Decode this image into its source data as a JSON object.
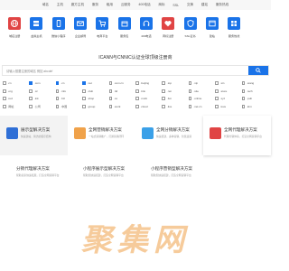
{
  "nav": {
    "items": [
      "域名",
      "主机",
      "魔方主机",
      "服务",
      "租用",
      "云服务",
      "400电话",
      "商标",
      "SSL",
      "交换",
      "建站",
      "服务热线"
    ]
  },
  "icons": [
    {
      "label": "域名注册",
      "color": "#e04444",
      "icon": "globe-icon"
    },
    {
      "label": "虚拟主机",
      "color": "#1a73e8",
      "icon": "server-icon"
    },
    {
      "label": "微信小程序",
      "color": "#1a73e8",
      "icon": "phone-icon"
    },
    {
      "label": "企业邮局",
      "color": "#1a73e8",
      "icon": "mail-icon"
    },
    {
      "label": "电商平台",
      "color": "#1a73e8",
      "icon": "cart-icon"
    },
    {
      "label": "服务包",
      "color": "#1a73e8",
      "icon": "box-icon"
    },
    {
      "label": "400电话",
      "color": "#1a73e8",
      "icon": "headset-icon"
    },
    {
      "label": "商标注册",
      "color": "#e04444",
      "icon": "heart-icon"
    },
    {
      "label": "SSL证书",
      "color": "#1a73e8",
      "icon": "shield-icon"
    },
    {
      "label": "建站",
      "color": "#1a73e8",
      "icon": "window-icon"
    },
    {
      "label": "服务热线",
      "color": "#1a73e8",
      "icon": "grid-icon"
    }
  ],
  "search": {
    "title": "ICANN与CNNIC认证全球顶级注册商",
    "placeholder": "请输入想要注册的域名 例如 abcdef"
  },
  "suffixes": [
    {
      "name": ".cn",
      "checked": false
    },
    {
      "name": ".com",
      "checked": true
    },
    {
      "name": ".cn",
      "checked": true
    },
    {
      "name": ".net",
      "checked": true
    },
    {
      "name": ".com.cn",
      "checked": false
    },
    {
      "name": ".beijing",
      "checked": false
    },
    {
      "name": ".top",
      "checked": false
    },
    {
      "name": ".vip",
      "checked": false
    },
    {
      "name": ".xin",
      "checked": false
    },
    {
      "name": ".wang",
      "checked": false
    },
    {
      "name": ".org",
      "checked": false
    },
    {
      "name": ".cc",
      "checked": false
    },
    {
      "name": ".info",
      "checked": false
    },
    {
      "name": ".club",
      "checked": false
    },
    {
      "name": ".ltd",
      "checked": false
    },
    {
      "name": ".link",
      "checked": false
    },
    {
      "name": ".ren",
      "checked": false
    },
    {
      "name": ".site",
      "checked": false
    },
    {
      "name": ".store",
      "checked": false
    },
    {
      "name": ".tech",
      "checked": false
    },
    {
      "name": ".red",
      "checked": false
    },
    {
      "name": ".ink",
      "checked": false
    },
    {
      "name": ".biz",
      "checked": false
    },
    {
      "name": ".shop",
      "checked": false
    },
    {
      "name": ".co",
      "checked": false
    },
    {
      "name": ".mobi",
      "checked": false
    },
    {
      "name": ".fun",
      "checked": false
    },
    {
      "name": ".online",
      "checked": false
    },
    {
      "name": ".xyz",
      "checked": false
    },
    {
      "name": ".pub",
      "checked": false
    },
    {
      "name": ".网址",
      "checked": false
    },
    {
      "name": ".公司",
      "checked": false
    },
    {
      "name": ".中国",
      "checked": false
    },
    {
      "name": ".group",
      "checked": false
    },
    {
      "name": ".work",
      "checked": false
    },
    {
      "name": ".cloud",
      "checked": false
    },
    {
      "name": ".live",
      "checked": false
    },
    {
      "name": ".net.cn",
      "checked": false
    },
    {
      "name": ".love",
      "checked": false
    },
    {
      "name": ".kim",
      "checked": false
    }
  ],
  "cards": [
    {
      "title": "展示型解决方案",
      "sub": "快速建站，简洁的展示结构",
      "color": "#2f6fd6"
    },
    {
      "title": "全网营销解决方案",
      "sub": "一站式营销推广，打通营销闭环",
      "color": "#f0a24a"
    },
    {
      "title": "全网分销解决方案",
      "sub": "快速搭建，多种营销，智慧运营",
      "color": "#3aa0e8"
    },
    {
      "title": "全网代理解决方案",
      "sub": "代理分销体系，打造全网营销平台",
      "color": "#e04444"
    },
    {
      "title": "分销代理解决方案",
      "sub": "帮助商家快速拓展，打造全网营销平台",
      "color": "#2f6fd6"
    },
    {
      "title": "小程序展示型解决方案",
      "sub": "帮助您快速搭建，打造全网营销平台",
      "color": "#2f6fd6"
    },
    {
      "title": "小程序营销型解决方案",
      "sub": "帮助您快速搭建，打造全网营销平台",
      "color": "#2f6fd6"
    }
  ],
  "watermark": "聚集网"
}
